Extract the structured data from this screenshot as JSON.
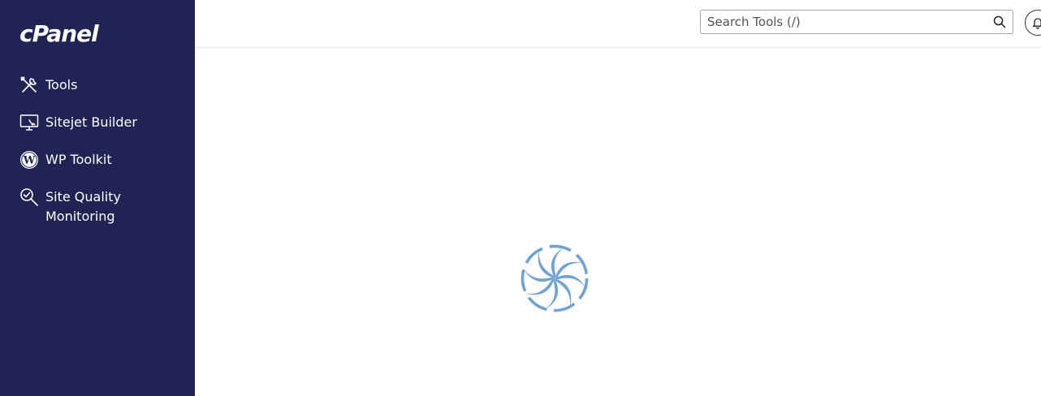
{
  "brand": {
    "logo_text": "cPanel",
    "sidebar_color": "#1f2455",
    "spinner_color": "#6fa3d8"
  },
  "sidebar": {
    "items": [
      {
        "label": "Tools",
        "icon": "tools-icon"
      },
      {
        "label": "Sitejet Builder",
        "icon": "monitor-icon"
      },
      {
        "label": "WP Toolkit",
        "icon": "wordpress-icon"
      },
      {
        "label": "Site Quality Monitoring",
        "icon": "magnifier-check-icon"
      }
    ]
  },
  "header": {
    "search": {
      "placeholder": "Search Tools (/)",
      "value": ""
    },
    "notifications_icon": "bell-icon"
  },
  "main": {
    "loading_icon": "loading-spinner-icon"
  }
}
